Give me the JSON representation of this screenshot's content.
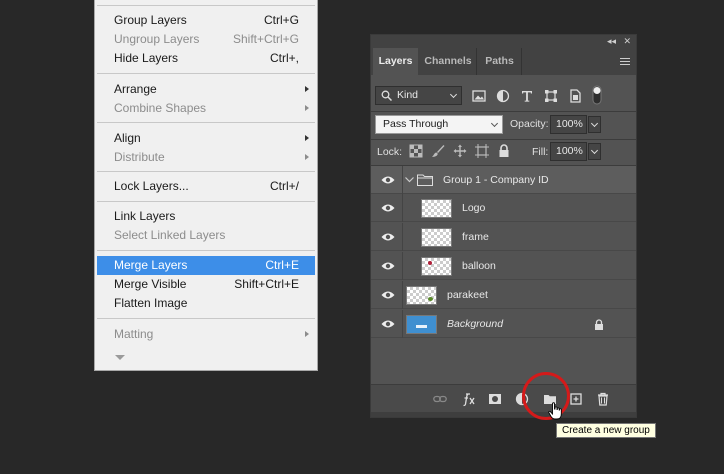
{
  "menu": {
    "items": [
      {
        "label": "Group Layers",
        "shortcut": "Ctrl+G",
        "disabled": false
      },
      {
        "label": "Ungroup Layers",
        "shortcut": "Shift+Ctrl+G",
        "disabled": true
      },
      {
        "label": "Hide Layers",
        "shortcut": "Ctrl+,",
        "disabled": false
      },
      {
        "label": "Arrange",
        "submenu": true,
        "disabled": false
      },
      {
        "label": "Combine Shapes",
        "submenu": true,
        "disabled": true
      },
      {
        "label": "Align",
        "submenu": true,
        "disabled": false
      },
      {
        "label": "Distribute",
        "submenu": true,
        "disabled": true
      },
      {
        "label": "Lock Layers...",
        "shortcut": "Ctrl+/",
        "disabled": false
      },
      {
        "label": "Link Layers",
        "disabled": false
      },
      {
        "label": "Select Linked Layers",
        "disabled": true
      },
      {
        "label": "Merge Layers",
        "shortcut": "Ctrl+E",
        "highlighted": true
      },
      {
        "label": "Merge Visible",
        "shortcut": "Shift+Ctrl+E",
        "disabled": false
      },
      {
        "label": "Flatten Image",
        "disabled": false
      },
      {
        "label": "Matting",
        "submenu": true,
        "disabled": true
      }
    ]
  },
  "panel": {
    "tabs": [
      "Layers",
      "Channels",
      "Paths"
    ],
    "active_tab": "Layers",
    "filter": {
      "kind_label": "Kind"
    },
    "blend_mode": "Pass Through",
    "opacity": {
      "label": "Opacity:",
      "value": "100%"
    },
    "lock": {
      "label": "Lock:"
    },
    "fill": {
      "label": "Fill:",
      "value": "100%"
    },
    "layers": [
      {
        "name": "Group 1 - Company ID",
        "type": "group",
        "expanded": true,
        "visible": true
      },
      {
        "name": "Logo",
        "type": "layer",
        "indent": true,
        "visible": true
      },
      {
        "name": "frame",
        "type": "layer",
        "indent": true,
        "visible": true
      },
      {
        "name": "balloon",
        "type": "layer",
        "indent": true,
        "visible": true
      },
      {
        "name": "parakeet",
        "type": "layer",
        "indent": false,
        "visible": true
      },
      {
        "name": "Background",
        "type": "background",
        "locked": true,
        "visible": true
      }
    ],
    "footer_icons": [
      "link-icon",
      "fx-icon",
      "mask-icon",
      "adjustment-icon",
      "new-group-icon",
      "new-layer-icon",
      "trash-icon"
    ]
  },
  "tooltip": {
    "text": "Create a new group"
  },
  "colors": {
    "highlight": "#3d8ee8",
    "annotation_circle": "#d41a1a",
    "panel_bg": "#535353"
  }
}
